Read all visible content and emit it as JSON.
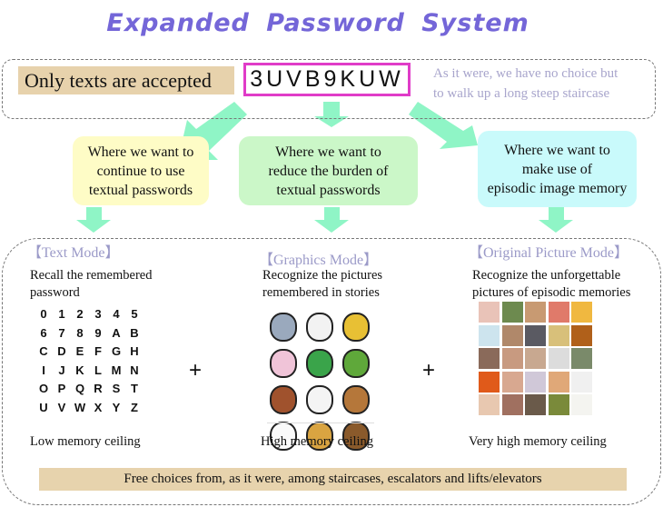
{
  "title": "Expanded  Password  System",
  "top": {
    "only_texts": "Only texts are accepted",
    "password": "3UVB9KUW",
    "note_line1": "As it were, we have no choice but",
    "note_line2": "to walk up a long steep staircase"
  },
  "contexts": [
    {
      "line1": "Where we want to",
      "line2": "continue to use",
      "line3": "textual passwords",
      "color": "#fefcc6"
    },
    {
      "line1": "Where we want to",
      "line2": "reduce the burden of",
      "line3": "textual passwords",
      "color": "#cbf7c8"
    },
    {
      "line1": "Where we want to",
      "line2": "make use of",
      "line3": "episodic image memory",
      "color": "#c9fafb"
    }
  ],
  "modes": [
    {
      "title": "【Text Mode】",
      "desc1": "Recall the remembered",
      "desc2": "password",
      "ceiling": "Low memory ceiling"
    },
    {
      "title": "【Graphics Mode】",
      "desc1": "Recognize the pictures",
      "desc2": "remembered in stories",
      "ceiling": "High memory ceiling"
    },
    {
      "title": "【Original Picture Mode】",
      "desc1": "Recognize the unforgettable",
      "desc2": "pictures of episodic memories",
      "ceiling": "Very high memory ceiling"
    }
  ],
  "plus": "+",
  "characters": [
    "0",
    "1",
    "2",
    "3",
    "4",
    "5",
    "6",
    "7",
    "8",
    "9",
    "A",
    "B",
    "C",
    "D",
    "E",
    "F",
    "G",
    "H",
    "I",
    "J",
    "K",
    "L",
    "M",
    "N",
    "O",
    "P",
    "Q",
    "R",
    "S",
    "T",
    "U",
    "V",
    "W",
    "X",
    "Y",
    "Z"
  ],
  "animal_icons": [
    {
      "icon": "rat-icon",
      "color": "#9aa9bd"
    },
    {
      "icon": "ox-icon",
      "color": "#f2f2f2"
    },
    {
      "icon": "tiger-icon",
      "color": "#e8c034"
    },
    {
      "icon": "rabbit-icon",
      "color": "#f0c4d8"
    },
    {
      "icon": "dragon-icon",
      "color": "#3aa44a"
    },
    {
      "icon": "snake-icon",
      "color": "#5fa83a"
    },
    {
      "icon": "horse-icon",
      "color": "#a0522d"
    },
    {
      "icon": "sheep-icon",
      "color": "#f4f4f4"
    },
    {
      "icon": "monkey-icon",
      "color": "#b5773a"
    },
    {
      "icon": "rooster-icon",
      "color": "#fafafa"
    },
    {
      "icon": "dog-icon",
      "color": "#d9a441"
    },
    {
      "icon": "boar-icon",
      "color": "#8a5a2b"
    }
  ],
  "photo_colors": [
    "#e9c3b8",
    "#6d8a4f",
    "#c89a72",
    "#e07a6a",
    "#f0b840",
    "#cde4ee",
    "#b0886a",
    "#5a5a62",
    "#d8c07a",
    "#b0601a",
    "#8a6a5a",
    "#c89a80",
    "#c8a890",
    "#dcdcdc",
    "#7a8a6a",
    "#e05a1a",
    "#d8a890",
    "#d0c8d8",
    "#e0a878",
    "#f0f0f0",
    "#e8c8b0",
    "#a07060",
    "#6a5a4a",
    "#7a8a3a",
    "#f4f4f0"
  ],
  "free_choice": "Free choices from, as it were, among staircases, escalators and lifts/elevators",
  "colors": {
    "title": "#7466d8",
    "password_border": "#e03cc8",
    "arrow": "#8ff5c6",
    "tan": "#e7d2ac",
    "mode_title": "#9b9ac8"
  }
}
